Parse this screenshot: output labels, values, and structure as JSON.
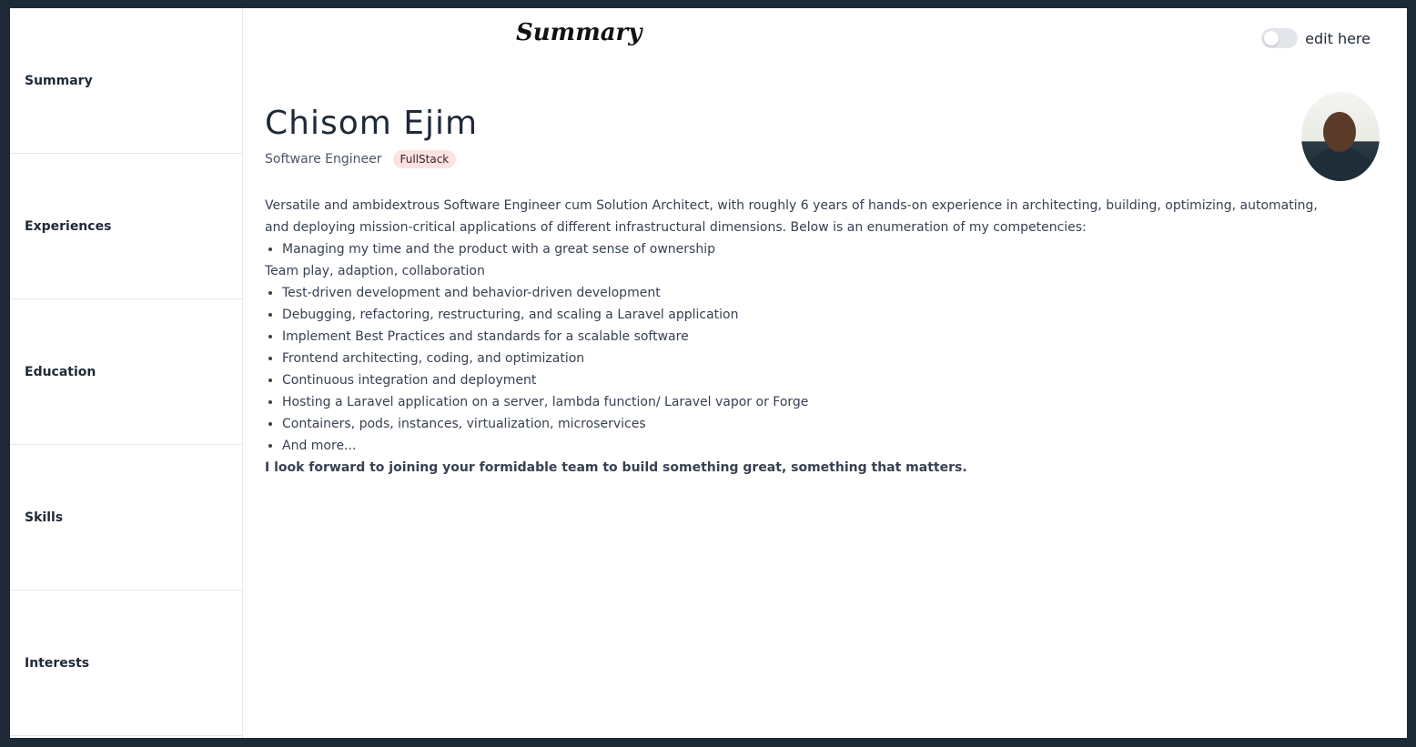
{
  "sidebar": {
    "items": [
      {
        "label": "Summary"
      },
      {
        "label": "Experiences"
      },
      {
        "label": "Education"
      },
      {
        "label": "Skills"
      },
      {
        "label": "Interests"
      }
    ]
  },
  "header": {
    "title": "Summary",
    "toggle_label": "edit here",
    "toggle_on": false
  },
  "profile": {
    "name": "Chisom Ejim",
    "role": "Software Engineer",
    "badge": "FullStack",
    "intro": "Versatile and ambidextrous Software Engineer cum Solution Architect, with roughly 6 years of hands-on experience in architecting, building, optimizing, automating, and deploying mission-critical applications of different infrastructural dimensions. Below is an enumeration of my competencies:",
    "bullets_a": [
      "Managing my time and the product with a great sense of ownership"
    ],
    "plain_line": "Team play, adaption, collaboration",
    "bullets_b": [
      "Test-driven development and behavior-driven development",
      "Debugging, refactoring, restructuring, and scaling a Laravel application",
      "Implement Best Practices and standards for a scalable software",
      "Frontend architecting, coding, and optimization",
      "Continuous integration and deployment",
      "Hosting a Laravel application on a server, lambda function/ Laravel vapor or Forge",
      "Containers, pods, instances, virtualization, microservices",
      "And more..."
    ],
    "closing": "I look forward to joining your formidable team to build something great, something that matters."
  },
  "colors": {
    "background": "#1e2a36",
    "badge_bg": "#fde2e2",
    "toggle_bg": "#e2e5ea"
  }
}
